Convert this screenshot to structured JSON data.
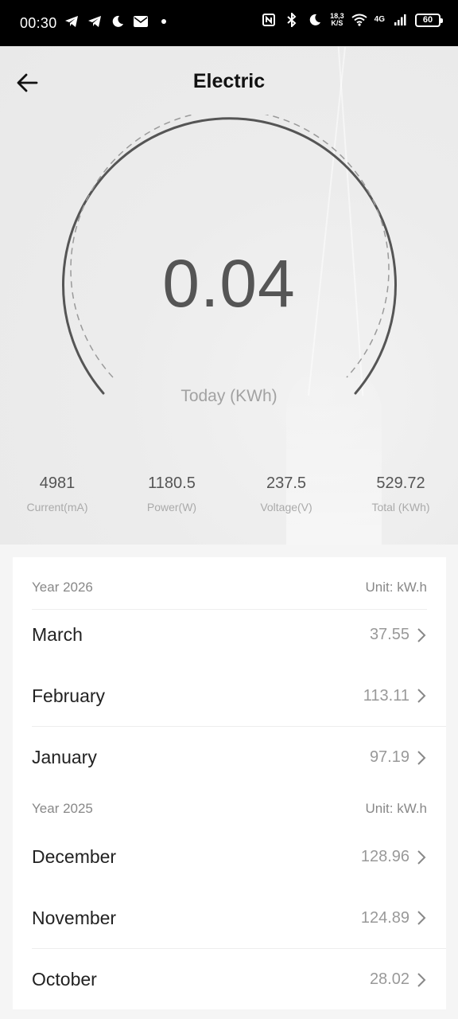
{
  "status_bar": {
    "time": "00:30",
    "net_speed_top": "18,3",
    "net_speed_bottom": "K/S",
    "network": "4G",
    "battery": "60",
    "left_icons": [
      "telegram-icon",
      "telegram-icon",
      "moon-icon",
      "mail-icon",
      "dot-icon"
    ],
    "right_icons": [
      "nfc-icon",
      "bluetooth-icon",
      "moon-icon",
      "wifi-icon",
      "signal-icon",
      "battery-icon"
    ]
  },
  "header": {
    "title": "Electric",
    "back_icon": "arrow-left-icon"
  },
  "gauge": {
    "value": "0.04",
    "label": "Today (KWh)"
  },
  "stats": [
    {
      "value": "4981",
      "label": "Current(mA)"
    },
    {
      "value": "1180.5",
      "label": "Power(W)"
    },
    {
      "value": "237.5",
      "label": "Voltage(V)"
    },
    {
      "value": "529.72",
      "label": "Total (KWh)"
    }
  ],
  "history": {
    "years": [
      {
        "year_label": "Year 2026",
        "unit_label": "Unit: kW.h",
        "months": [
          {
            "month": "March",
            "value": "37.55"
          },
          {
            "month": "February",
            "value": "113.11"
          },
          {
            "month": "January",
            "value": "97.19"
          }
        ]
      },
      {
        "year_label": "Year 2025",
        "unit_label": "Unit: kW.h",
        "months": [
          {
            "month": "December",
            "value": "128.96"
          },
          {
            "month": "November",
            "value": "124.89"
          },
          {
            "month": "October",
            "value": "28.02"
          }
        ]
      }
    ]
  },
  "colors": {
    "status_bar": "#000000",
    "title": "#111111",
    "gauge_value": "#555555",
    "muted": "#999999"
  }
}
